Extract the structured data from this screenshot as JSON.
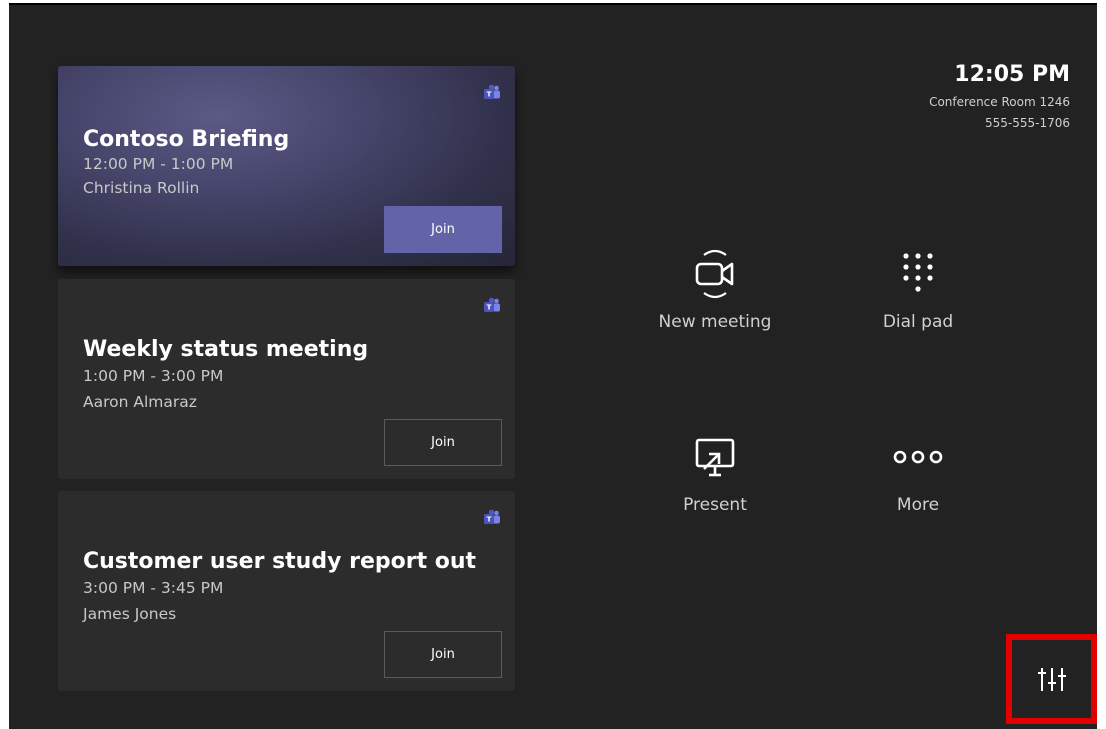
{
  "header": {
    "time": "12:05 PM",
    "room": "Conference Room 1246",
    "phone": "555-555-1706"
  },
  "meetings": [
    {
      "title": "Contoso Briefing",
      "time": "12:00 PM - 1:00 PM",
      "organizer": "Christina Rollin",
      "join_label": "Join"
    },
    {
      "title": "Weekly status meeting",
      "time": "1:00 PM - 3:00 PM",
      "organizer": "Aaron Almaraz",
      "join_label": "Join"
    },
    {
      "title": "Customer user study report out",
      "time": "3:00 PM - 3:45 PM",
      "organizer": "James Jones",
      "join_label": "Join"
    }
  ],
  "actions": {
    "new_meeting": "New meeting",
    "dial_pad": "Dial pad",
    "present": "Present",
    "more": "More"
  },
  "icons": {
    "teams": "teams-logo-icon",
    "new_meeting": "video-camera-icon",
    "dial_pad": "dial-pad-icon",
    "present": "share-screen-icon",
    "more": "more-icon",
    "settings": "sliders-settings-icon"
  },
  "colors": {
    "background": "#222222",
    "card": "#2d2c2c",
    "accent": "#6264a7",
    "highlight": "#e00000"
  }
}
